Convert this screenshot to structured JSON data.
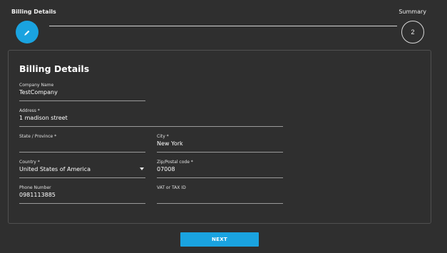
{
  "stepper": {
    "steps": [
      {
        "label": "Billing Details",
        "state": "active",
        "icon": "pencil-icon"
      },
      {
        "label": "Summary",
        "state": "pending",
        "number": "2"
      }
    ],
    "accent_color": "#1aa3e0"
  },
  "form": {
    "title": "Billing Details",
    "fields": {
      "company_name": {
        "label": "Company Name",
        "value": "TestCompany"
      },
      "address": {
        "label": "Address *",
        "value": "1 madison street"
      },
      "state": {
        "label": "State / Province *",
        "value": ""
      },
      "city": {
        "label": "City *",
        "value": "New York"
      },
      "country": {
        "label": "Country *",
        "value": "United States of America"
      },
      "zip": {
        "label": "Zip/Postal code *",
        "value": "07008"
      },
      "phone": {
        "label": "Phone Number",
        "value": "0981113885"
      },
      "vat": {
        "label": "VAT or TAX ID",
        "value": ""
      }
    }
  },
  "actions": {
    "next_label": "NEXT"
  }
}
